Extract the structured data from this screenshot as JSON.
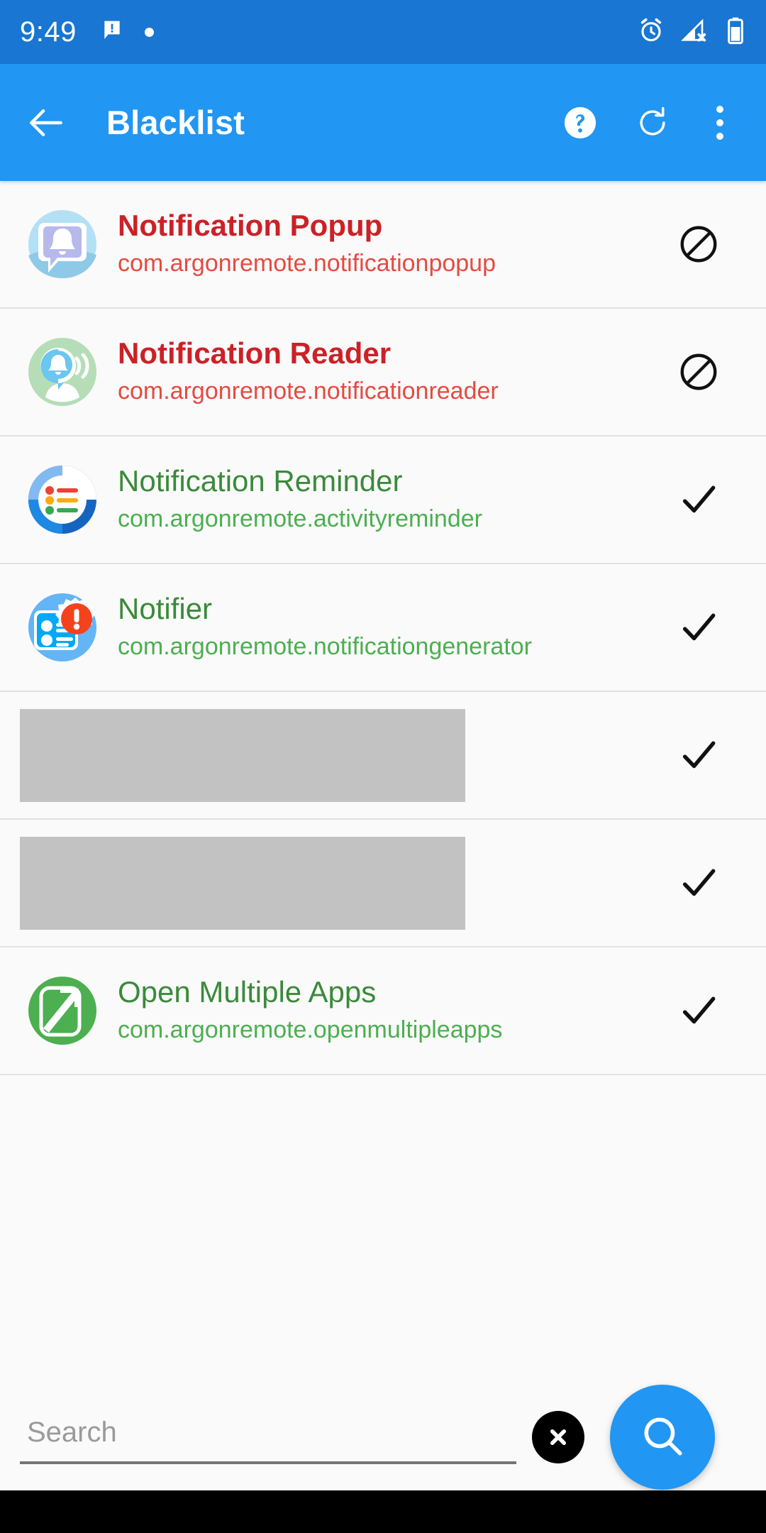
{
  "status_bar": {
    "time": "9:49",
    "icons_left": [
      "message-icon",
      "dot-icon"
    ],
    "icons_right": [
      "alarm-icon",
      "signal-off-icon",
      "battery-icon"
    ],
    "background": "#1976D2"
  },
  "app_bar": {
    "back_label": "back-arrow",
    "title": "Blacklist",
    "actions": [
      "help-icon",
      "refresh-icon",
      "overflow-menu-icon"
    ],
    "background": "#2196F3"
  },
  "colors": {
    "blocked_title": "#CC2127",
    "blocked_pkg": "#E44B42",
    "allowed_title": "#3A8A3A",
    "allowed_pkg": "#4CAF50",
    "accent": "#2196F3",
    "redacted": "#C2C2C2"
  },
  "list": {
    "items": [
      {
        "name": "Notification Popup",
        "package": "com.argonremote.notificationpopup",
        "state": "blocked",
        "state_icon": "block-icon",
        "icon": "notification-popup-app-icon",
        "redacted": false
      },
      {
        "name": "Notification Reader",
        "package": "com.argonremote.notificationreader",
        "state": "blocked",
        "state_icon": "block-icon",
        "icon": "notification-reader-app-icon",
        "redacted": false
      },
      {
        "name": "Notification Reminder",
        "package": "com.argonremote.activityreminder",
        "state": "allowed",
        "state_icon": "check-icon",
        "icon": "notification-reminder-app-icon",
        "redacted": false
      },
      {
        "name": "Notifier",
        "package": "com.argonremote.notificationgenerator",
        "state": "allowed",
        "state_icon": "check-icon",
        "icon": "notifier-app-icon",
        "redacted": false
      },
      {
        "name": "",
        "package": "",
        "state": "allowed",
        "state_icon": "check-icon",
        "icon": "redacted-placeholder",
        "redacted": true
      },
      {
        "name": "",
        "package": "",
        "state": "allowed",
        "state_icon": "check-icon",
        "icon": "redacted-placeholder",
        "redacted": true
      },
      {
        "name": "Open Multiple Apps",
        "package": "com.argonremote.openmultipleapps",
        "state": "allowed",
        "state_icon": "check-icon",
        "icon": "open-multiple-apps-app-icon",
        "redacted": false
      }
    ]
  },
  "search": {
    "value": "",
    "placeholder": "Search",
    "clear_icon": "close-circle-icon",
    "fab_icon": "search-icon"
  }
}
